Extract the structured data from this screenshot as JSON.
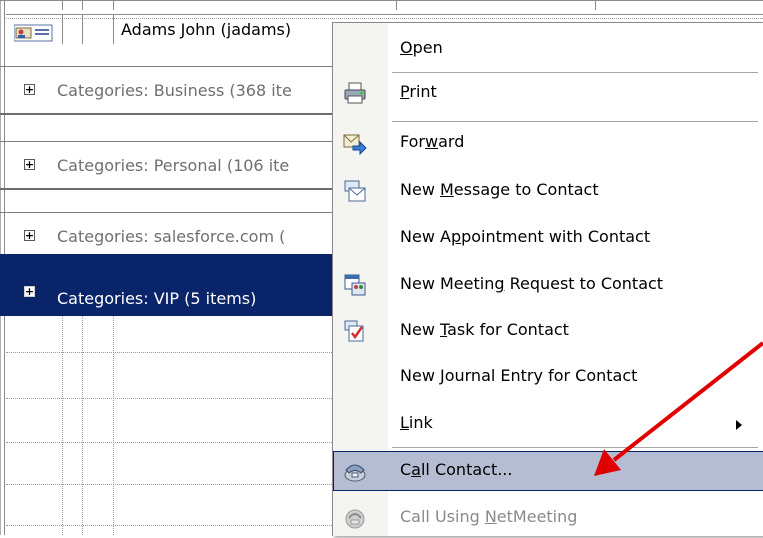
{
  "contact_row": {
    "name": "Adams John (jadams)"
  },
  "category_rows": [
    {
      "label": "Categories: Business (368 ite",
      "expander": "+",
      "selected": false
    },
    {
      "label": "Categories: Personal (106 ite",
      "expander": "+",
      "selected": false
    },
    {
      "label": "Categories: salesforce.com (",
      "expander": "+",
      "selected": false
    },
    {
      "label": "Categories: VIP (5 items)",
      "expander": "+",
      "selected": true
    }
  ],
  "context_menu": {
    "items": [
      {
        "label": "Open",
        "accel": "O",
        "icon": "none",
        "enabled": true
      },
      {
        "label": "Print",
        "accel": "P",
        "icon": "printer-icon",
        "enabled": true
      },
      {
        "label": "Forward",
        "accel": "w",
        "icon": "forward-icon",
        "enabled": true
      },
      {
        "label": "New Message to Contact",
        "accel": "M",
        "icon": "new-message-icon",
        "enabled": true
      },
      {
        "label": "New Appointment with Contact",
        "accel": "p",
        "icon": "none",
        "enabled": true
      },
      {
        "label": "New Meeting Request to Contact",
        "accel": "g",
        "icon": "meeting-request-icon",
        "enabled": true
      },
      {
        "label": "New Task for Contact",
        "accel": "T",
        "icon": "task-icon",
        "enabled": true
      },
      {
        "label": "New Journal Entry for Contact",
        "accel": "J",
        "icon": "none",
        "enabled": true
      },
      {
        "label": "Link",
        "accel": "L",
        "icon": "none",
        "enabled": true,
        "submenu": true
      },
      {
        "label": "Call Contact...",
        "accel": "a",
        "icon": "phone-icon",
        "enabled": true,
        "hover": true
      },
      {
        "label": "Call Using NetMeeting",
        "accel": "N",
        "icon": "netmeeting-icon",
        "enabled": false
      }
    ]
  },
  "colors": {
    "selection_bg": "#0a246a",
    "menu_hover_bg": "#b6bdd2",
    "annotation_arrow": "#e00000",
    "disabled_text": "#8a8a8a"
  }
}
